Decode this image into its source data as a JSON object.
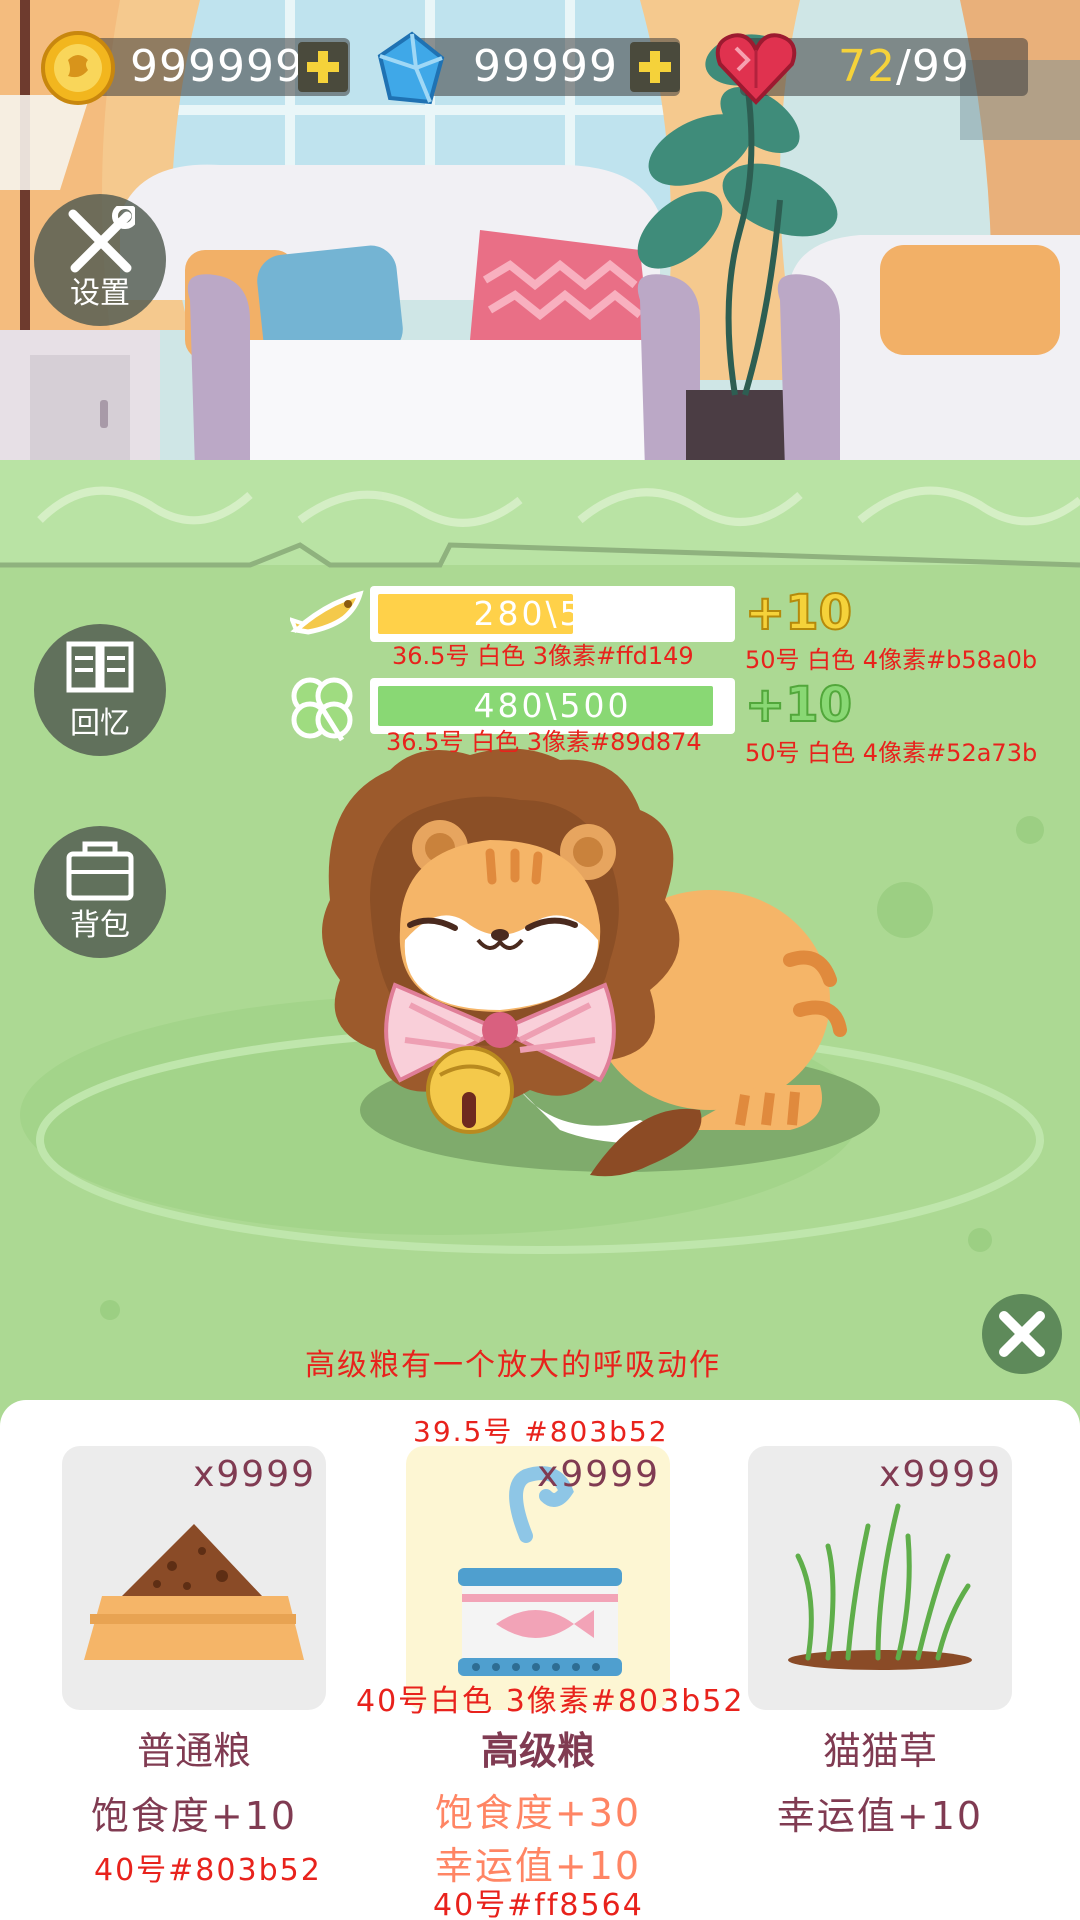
{
  "resources": {
    "coins": "999999",
    "gems": "99999",
    "hearts_current": "72",
    "hearts_max": "/99"
  },
  "side_buttons": {
    "settings": "设置",
    "memories": "回忆",
    "backpack": "背包"
  },
  "status": {
    "satiety": {
      "text": "280\\500",
      "fill": 0.56,
      "gain": "+10",
      "color": "#ffd149",
      "gain_color": "#b58a0b"
    },
    "luck": {
      "text": "480\\500",
      "fill": 0.96,
      "gain": "+10",
      "color": "#89d874",
      "gain_color": "#52a73b"
    }
  },
  "annotations": {
    "satiety_bar": "36.5号  白色  3像素#ffd149",
    "satiety_gain": "50号  白色  4像素#b58a0b",
    "luck_bar": "36.5号  白色  3像素#89d874",
    "luck_gain": "50号  白色  4像素#52a73b",
    "premium_breath": "高级粮有一个放大的呼吸动作",
    "count_font": "39.5号  #803b52",
    "premium_name_font": "40号白色  3像素#803b52",
    "normal_effect_font": "40号#803b52",
    "premium_effect_font": "40号#ff8564"
  },
  "foods": [
    {
      "name": "普通粮",
      "count": "x9999",
      "effects": [
        "饱食度+10"
      ],
      "icon": "kibble-icon",
      "card_bg": "#ececec",
      "effect_color": "#803b52"
    },
    {
      "name": "高级粮",
      "count": "x9999",
      "effects": [
        "饱食度+30",
        "幸运值+10"
      ],
      "icon": "fish-can-icon",
      "card_bg": "#fdf6d3",
      "effect_color": "#ff8564"
    },
    {
      "name": "猫猫草",
      "count": "x9999",
      "effects": [
        "幸运值+10"
      ],
      "icon": "cat-grass-icon",
      "card_bg": "#ececec",
      "effect_color": "#803b52"
    }
  ],
  "colors": {
    "brown_text": "#803b52",
    "annotation_red": "#e8221c",
    "premium_effect": "#ff8564"
  }
}
